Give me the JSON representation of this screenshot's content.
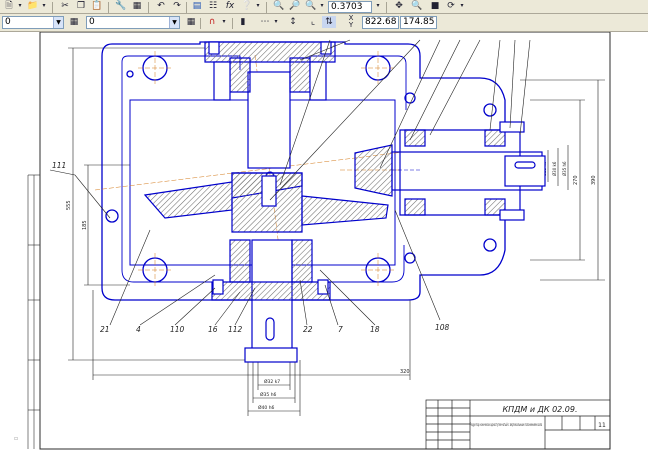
{
  "toolbar_top": {
    "zoom_value": "0.3703",
    "icons": [
      "new-document",
      "open",
      "cut",
      "copy",
      "paste",
      "properties",
      "undo",
      "redo",
      "tree",
      "fx",
      "help-cursor",
      "zoom-in",
      "zoom-out",
      "zoom-window",
      "zoom-scale",
      "pan",
      "refresh"
    ]
  },
  "toolbar_second": {
    "layer_combo": "0",
    "style_combo": "0",
    "coord_x_label": "X",
    "coord_y_label": "Y",
    "coord_x": "822.68",
    "coord_y": "174.85"
  },
  "drawing": {
    "line_color": "#0000cc",
    "hatch_color": "#777777",
    "axis_color": "#d47a1a",
    "leader_labels": [
      "111",
      "21",
      "4",
      "110",
      "16",
      "112",
      "22",
      "7",
      "18",
      "108"
    ],
    "dims_vertical_left": [
      "555",
      "185"
    ],
    "dims_vertical_right": [
      "390",
      "270"
    ],
    "dim_horizontal_bottom": "320",
    "shaft_dims": [
      "Ø32 k7",
      "Ø35 h6",
      "Ø40 h6"
    ],
    "output_dims": [
      "Ø25 k6",
      "Ø30 k6",
      "Ø35 h6"
    ],
    "title_block": {
      "designation": "КПДМ и ДК 02.09.",
      "name": "Редуктор конически одноступенчатый с вертикальным положением вала",
      "sheet": "11"
    }
  }
}
